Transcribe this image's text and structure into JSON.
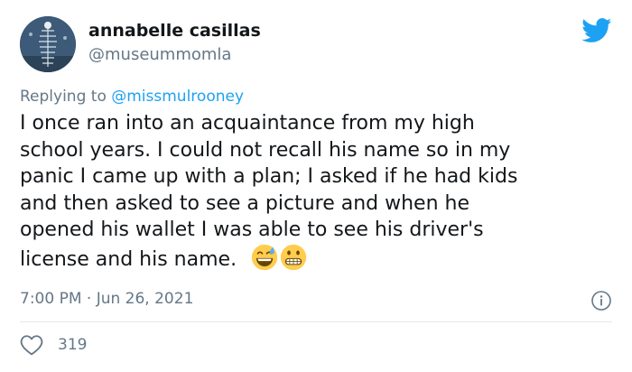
{
  "user": {
    "display_name": "annabelle casillas",
    "handle": "@museummomla"
  },
  "reply": {
    "prefix": "Replying to ",
    "mention": "@missmulrooney"
  },
  "tweet": {
    "lines": [
      "I once ran into an acquaintance from my high",
      "school years. I could not recall his name so in my",
      "panic I came up with a plan; I asked if he had kids",
      "and then asked to see a picture and when he",
      "opened his wallet I was able to see his driver's",
      "license and his name."
    ],
    "emojis": [
      "grinning-sweat-emoji",
      "grimacing-emoji"
    ]
  },
  "meta": {
    "timestamp": "7:00 PM · Jun 26, 2021"
  },
  "engagement": {
    "likes": "319"
  },
  "icons": {
    "brand": "twitter-bird-icon",
    "info": "info-icon",
    "like": "heart-icon"
  },
  "colors": {
    "accent": "#1da1f2",
    "secondary_text": "#657786",
    "divider": "#e1e8ed"
  }
}
